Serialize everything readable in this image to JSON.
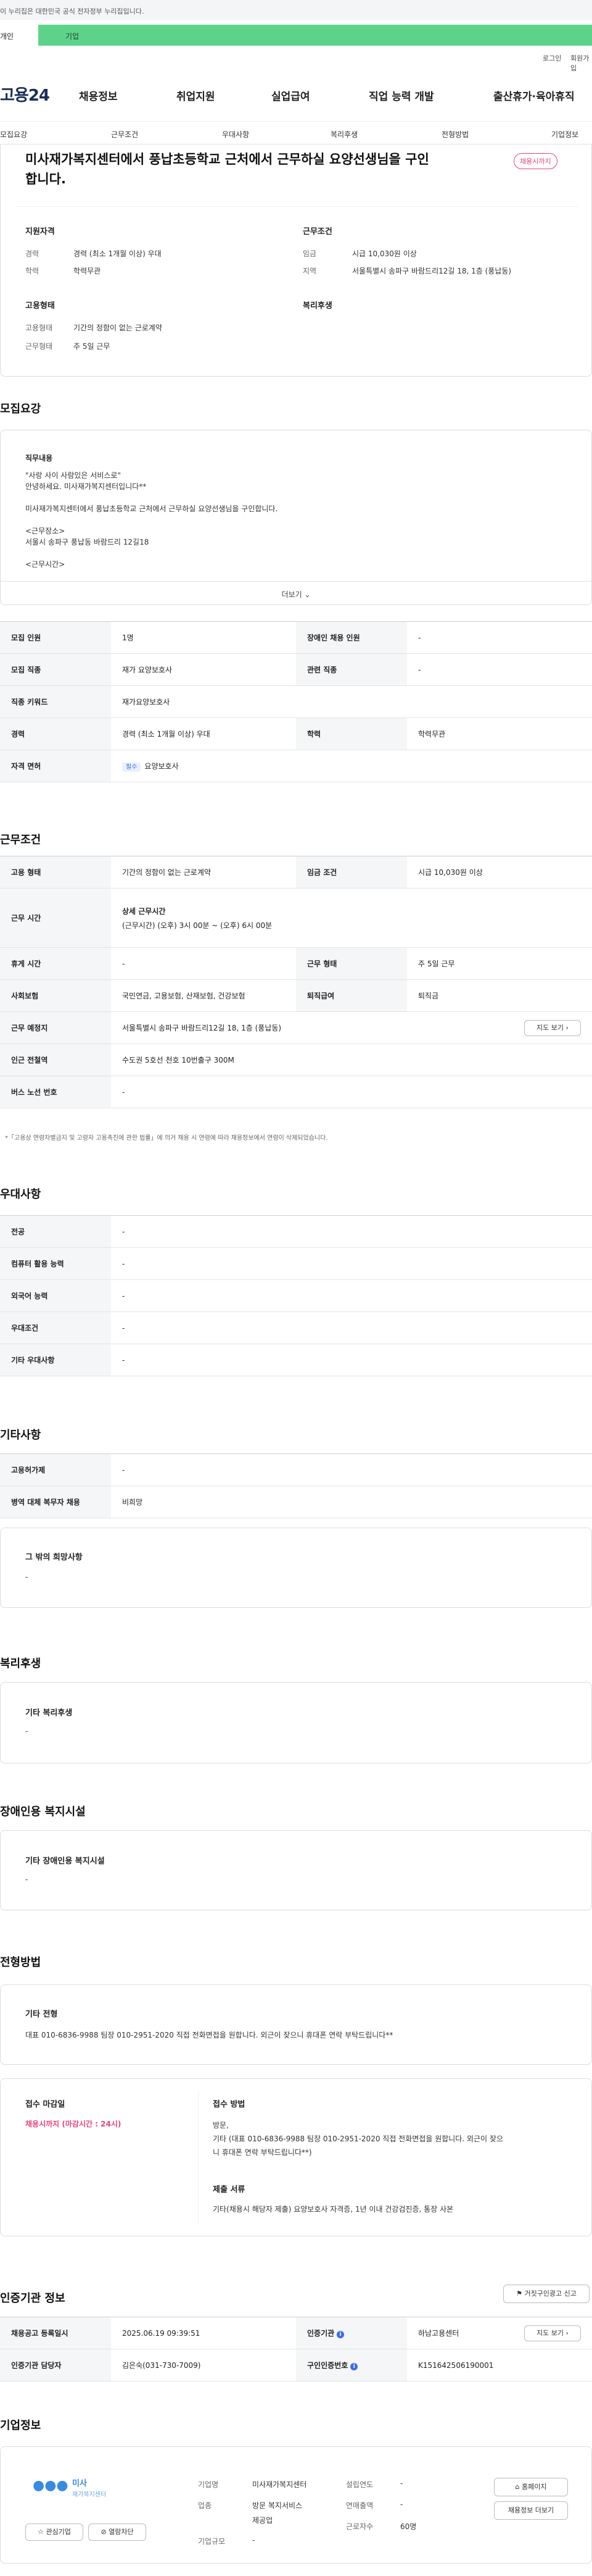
{
  "gov_banner": "이 누리집은 대한민국 공식 전자정부 누리집입니다.",
  "tabs": {
    "personal": "개인",
    "company": "기업"
  },
  "util": {
    "login": "로그인",
    "join": "회원가입"
  },
  "logo": "고용24",
  "gnb": [
    "채용정보",
    "취업지원",
    "실업급여",
    "직업 능력 개발",
    "출산휴가·육아휴직"
  ],
  "subnav": [
    "모집요강",
    "근무조건",
    "우대사항",
    "복리후생",
    "전형방법",
    "기업정보"
  ],
  "job": {
    "title_line1": "미사재가복지센터에서 풍납초등학교 근처에서 근무하실 요양선생님을 구인",
    "title_line2": "합니다.",
    "badge": "채용시까지",
    "qual_title": "지원자격",
    "career_label": "경력",
    "career_value": "경력 (최소 1개월 이상) 우대",
    "edu_label": "학력",
    "edu_value": "학력무관",
    "emp_title": "고용형태",
    "emptype_label": "고용형태",
    "emptype_value": "기간의 정함이 없는 근로계약",
    "workform_label": "근무형태",
    "workform_value": "주 5일 근무",
    "cond_title": "근무조건",
    "wage_label": "임금",
    "wage_value": "시급 10,030원 이상",
    "region_label": "지역",
    "region_value": "서울특별시 송파구 바람드리12길 18, 1층 (풍납동)",
    "welfare_title": "복리후생"
  },
  "recruit": {
    "title": "모집요강",
    "duty_title": "직무내용",
    "duty_lines": [
      "\"사랑 사이 사람있은 서비스로\"",
      "안녕하세요. 미사재가복지센터입니다**",
      "",
      "미사재가복지센터에서 풍납초등학교 근처에서 근무하실 요양선생님을 구인합니다.",
      "",
      "<근무장소>",
      "서울시 송파구 풍납동 바람드리 12길18",
      "",
      "<근무시간>"
    ],
    "more": "더보기",
    "rows": [
      {
        "k1": "모집 인원",
        "v1": "1명",
        "k2": "장애인 채용 인원",
        "v2": "-"
      },
      {
        "k1": "모집 직종",
        "v1": "재가 요양보호사",
        "k2": "관련 직종",
        "v2": "-"
      },
      {
        "k1": "직종 키워드",
        "v1": "재가요양보호사",
        "k2": "",
        "v2": ""
      },
      {
        "k1": "경력",
        "v1": "경력 (최소 1개월 이상) 우대",
        "k2": "학력",
        "v2": "학력무관"
      },
      {
        "k1": "자격 면허",
        "v1": "요양보호사",
        "k2": "",
        "v2": ""
      }
    ],
    "license_chip": "필수"
  },
  "work": {
    "title": "근무조건",
    "emp_k": "고용 형태",
    "emp_v": "기간의 정함이 없는 근로계약",
    "wage_k": "임금 조건",
    "wage_v": "시급 10,030원 이상",
    "hours_k": "근무 시간",
    "hours_title": "상세 근무시간",
    "hours_v": "(근무시간) (오후) 3시 00분 ~ (오후) 6시 00분",
    "break_k": "휴게 시간",
    "break_v": "-",
    "form_k": "근무 형태",
    "form_v": "주 5일 근무",
    "ins_k": "사회보험",
    "ins_v": "국민연금, 고용보험, 산재보험, 건강보험",
    "sev_k": "퇴직급여",
    "sev_v": "퇴직금",
    "place_k": "근무 예정지",
    "place_v": "서울특별시 송파구 바람드리12길 18, 1층 (풍납동)",
    "map_btn": "지도 보기",
    "subway_k": "인근 전철역",
    "subway_v": "수도권 5호선 천호 10번출구 300M",
    "bus_k": "버스 노선 번호",
    "bus_v": "-",
    "note": "*「고용상 연령차별금지 및 고령자 고용촉진에 관한 법률」에 의거 채용 시 연령에 따라 채용정보에서 연령이 삭제되었습니다."
  },
  "pref": {
    "title": "우대사항",
    "rows": [
      {
        "k": "전공",
        "v": "-"
      },
      {
        "k": "컴퓨터 활용 능력",
        "v": "-"
      },
      {
        "k": "외국어 능력",
        "v": "-"
      },
      {
        "k": "우대조건",
        "v": "-"
      },
      {
        "k": "기타 우대사항",
        "v": "-"
      }
    ]
  },
  "etc": {
    "title": "기타사항",
    "rows": [
      {
        "k": "고용허가제",
        "v": "-"
      },
      {
        "k": "병역 대체 복무자 채용",
        "v": "비희망"
      }
    ],
    "other_title": "그 밖의 희망사항",
    "other_value": "-"
  },
  "welfare": {
    "title": "복리후생",
    "sub": "기타 복리후생",
    "value": "-"
  },
  "disabled": {
    "title": "장애인용 복지시설",
    "sub": "기타 장애인용 복지시설",
    "value": "-"
  },
  "screen": {
    "title": "전형방법",
    "etc_title": "기타 전형",
    "etc_value": "대표 010-6836-9988 팀장 010-2951-2020 직접 전화면접을 원합니다. 외근이 잦으니 휴대폰 연락 부탁드립니다**",
    "deadline_title": "접수 마감일",
    "deadline_value": "채용시까지 (마감시간 : 24시)",
    "method_title": "접수 방법",
    "method_lines": [
      "방문,",
      "기타 (대표 010-6836-9988 팀장 010-2951-2020 직접 전화면접을 원합니다. 외근이 잦으",
      "니 휴대폰 연락 부탁드립니다**)"
    ],
    "docs_title": "제출 서류",
    "docs_value": "기타(채용시 해당자 제출) 요양보호사 자격증, 1년 이내 건강검진증, 통장 사본"
  },
  "cert": {
    "title": "인증기관 정보",
    "report_btn": "거짓구인광고 신고",
    "reg_k": "채용공고 등록일시",
    "reg_v": "2025.06.19 09:39:51",
    "org_k": "인증기관",
    "org_v": "하남고용센터",
    "map_btn": "지도 보기",
    "manager_k": "인증기관 담당자",
    "manager_v": "김은숙(031-730-7009)",
    "num_k": "구인인증번호",
    "num_v": "K151642506190001"
  },
  "company": {
    "title": "기업정보",
    "logo_text": "미사",
    "logo_sub": "재가복지센터",
    "fav_btn": "관심기업",
    "follow_btn": "열람차단",
    "name_k": "기업명",
    "name_v": "미사재가복지센터",
    "biz_k": "업종",
    "biz_v1": "방문 복지서비스",
    "biz_v2": "제공업",
    "size_k": "기업규모",
    "size_v": "-",
    "est_k": "설립연도",
    "est_v": "-",
    "sales_k": "연매출액",
    "sales_v": "-",
    "emp_k": "근로자수",
    "emp_v": "60명",
    "home_btn": "홈페이지",
    "jobs_btn": "채용정보 더보기"
  }
}
